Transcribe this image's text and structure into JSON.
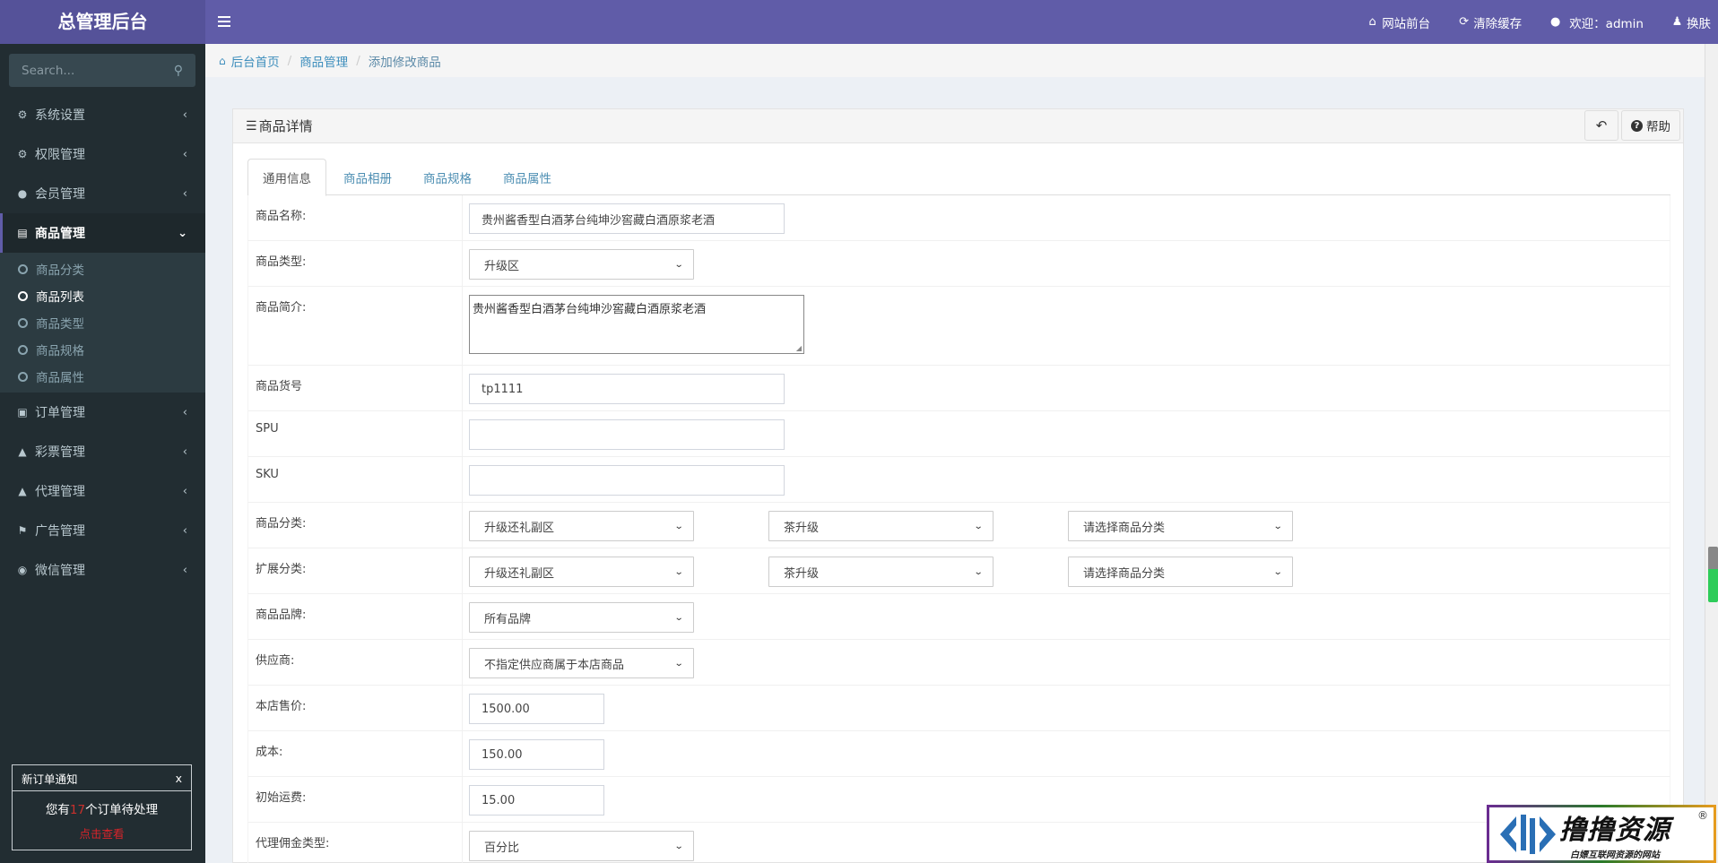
{
  "app": {
    "title": "总管理后台"
  },
  "topnav": {
    "items": [
      {
        "icon": "home-icon",
        "label": "网站前台"
      },
      {
        "icon": "refresh-icon",
        "label": "清除缓存"
      },
      {
        "icon": "user-icon",
        "label": "欢迎：admin"
      },
      {
        "icon": "skin-icon",
        "label": "换肤"
      }
    ]
  },
  "sidebar": {
    "search_placeholder": "Search...",
    "menu": [
      {
        "icon": "gear-icon",
        "label": "系统设置"
      },
      {
        "icon": "cogs-icon",
        "label": "权限管理"
      },
      {
        "icon": "user-icon",
        "label": "会员管理"
      },
      {
        "icon": "book-icon",
        "label": "商品管理",
        "expanded": true,
        "children": [
          {
            "label": "商品分类"
          },
          {
            "label": "商品列表",
            "active": true
          },
          {
            "label": "商品类型"
          },
          {
            "label": "商品规格"
          },
          {
            "label": "商品属性"
          }
        ]
      },
      {
        "icon": "money-icon",
        "label": "订单管理"
      },
      {
        "icon": "bell-icon",
        "label": "彩票管理"
      },
      {
        "icon": "bell-icon",
        "label": "代理管理"
      },
      {
        "icon": "flag-icon",
        "label": "广告管理"
      },
      {
        "icon": "wechat-icon",
        "label": "微信管理"
      }
    ]
  },
  "notice": {
    "title": "新订单通知",
    "close": "x",
    "prefix": "您有",
    "count": "17",
    "suffix": "个订单待处理",
    "link": "点击查看"
  },
  "breadcrumb": {
    "items": [
      "后台首页",
      "商品管理",
      "添加修改商品"
    ]
  },
  "card": {
    "title": "商品详情",
    "help_label": "帮助",
    "tabs": [
      "通用信息",
      "商品相册",
      "商品规格",
      "商品属性"
    ],
    "active_tab": 0
  },
  "form": {
    "name": {
      "label": "商品名称:",
      "value": "贵州酱香型白酒茅台纯坤沙窖藏白酒原浆老酒"
    },
    "type": {
      "label": "商品类型:",
      "value": "升级区"
    },
    "brief": {
      "label": "商品简介:",
      "value": "贵州酱香型白酒茅台纯坤沙窖藏白酒原浆老酒"
    },
    "sn": {
      "label": "商品货号",
      "value": "tp1111"
    },
    "spu": {
      "label": "SPU",
      "value": ""
    },
    "sku": {
      "label": "SKU",
      "value": ""
    },
    "category": {
      "label": "商品分类:",
      "values": [
        "升级还礼副区",
        "茶升级",
        "请选择商品分类"
      ]
    },
    "ext_category": {
      "label": "扩展分类:",
      "values": [
        "升级还礼副区",
        "茶升级",
        "请选择商品分类"
      ]
    },
    "brand": {
      "label": "商品品牌:",
      "value": "所有品牌"
    },
    "supplier": {
      "label": "供应商:",
      "value": "不指定供应商属于本店商品"
    },
    "shop_price": {
      "label": "本店售价:",
      "value": "1500.00"
    },
    "cost": {
      "label": "成本:",
      "value": "150.00"
    },
    "shipping": {
      "label": "初始运费:",
      "value": "15.00"
    },
    "commission_type": {
      "label": "代理佣金类型:",
      "value": "百分比"
    }
  },
  "watermark": {
    "title": "撸撸资源",
    "subtitle": "白嫖互联网资源的网站",
    "reg": "®"
  }
}
